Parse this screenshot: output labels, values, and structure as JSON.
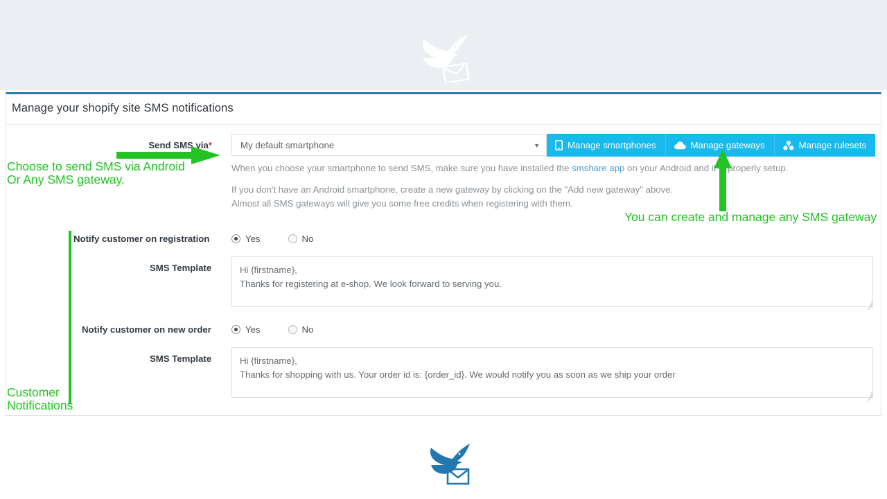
{
  "header": {
    "logo_icon": "dove-envelope-logo"
  },
  "panel": {
    "title": "Manage your shopify site SMS notifications"
  },
  "form": {
    "send_sms_via": {
      "label": "Send SMS via",
      "required_marker": "*",
      "selected_value": "My default smartphone",
      "caret_icon": "chevron-down-icon"
    },
    "buttons": [
      {
        "label": "Manage smartphones",
        "icon": "mobile-phone-icon"
      },
      {
        "label": "Manage gateways",
        "icon": "cloud-icon"
      },
      {
        "label": "Manage rulesets",
        "icon": "cubes-icon"
      }
    ],
    "help": {
      "line1_before_link": "When you choose your smartphone to send SMS, make sure you have installed the ",
      "link_text": "smshare app",
      "line1_after_link": " on your Android and it is properly setup.",
      "line2": "If you don't have an Android smartphone, create a new gateway by clicking on the \"Add new gateway\" above.",
      "line3": "Almost all SMS gateways will give you some free credits when registering with them."
    },
    "notify_registration": {
      "label": "Notify customer on registration",
      "options": [
        "Yes",
        "No"
      ],
      "selected": "Yes",
      "template_label": "SMS Template",
      "template_value": "Hi {firstname},\nThanks for registering at e-shop. We look forward to serving you."
    },
    "notify_new_order": {
      "label": "Notify customer on new order",
      "options": [
        "Yes",
        "No"
      ],
      "selected": "Yes",
      "template_label": "SMS Template",
      "template_value": "Hi {firstname},\nThanks for shopping with us. Your order id is: {order_id}. We would notify you as soon as we ship your order"
    }
  },
  "annotations": {
    "color": "#22c322",
    "left_top": "Choose to send SMS via Android\nOr Any SMS gateway.",
    "right": "You can create and manage any SMS gateway",
    "left_bottom": "Customer\nNotifications"
  },
  "footer": {
    "logo_icon": "dove-envelope-logo"
  },
  "colors": {
    "panel_top_border": "#2a7ab0",
    "button_bg": "#18b9ec",
    "annotation_green": "#22c322",
    "link_blue": "#4a9ed8",
    "header_band": "#ebeef3",
    "logo_blue": "#2277b0"
  }
}
